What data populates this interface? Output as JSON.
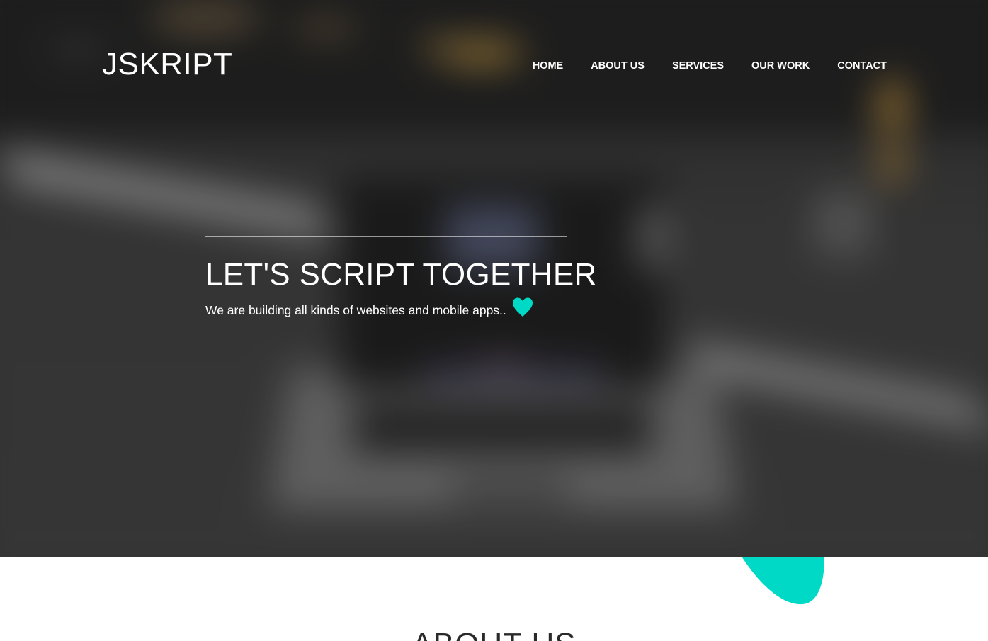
{
  "brand": {
    "logo_text": "JSKRIPT"
  },
  "nav": {
    "items": [
      {
        "label": "HOME"
      },
      {
        "label": "ABOUT US"
      },
      {
        "label": "SERVICES"
      },
      {
        "label": "OUR WORK"
      },
      {
        "label": "CONTACT"
      }
    ]
  },
  "hero": {
    "title": "LET'S SCRIPT TOGETHER",
    "subtitle": "We are building all kinds of websites and mobile apps..",
    "icon": "heart-icon"
  },
  "about": {
    "heading": "ABOUT US"
  },
  "colors": {
    "accent": "#00d9c5",
    "text_light": "#ffffff",
    "text_dark": "#2a2a2a",
    "hero_bg": "#262626"
  }
}
